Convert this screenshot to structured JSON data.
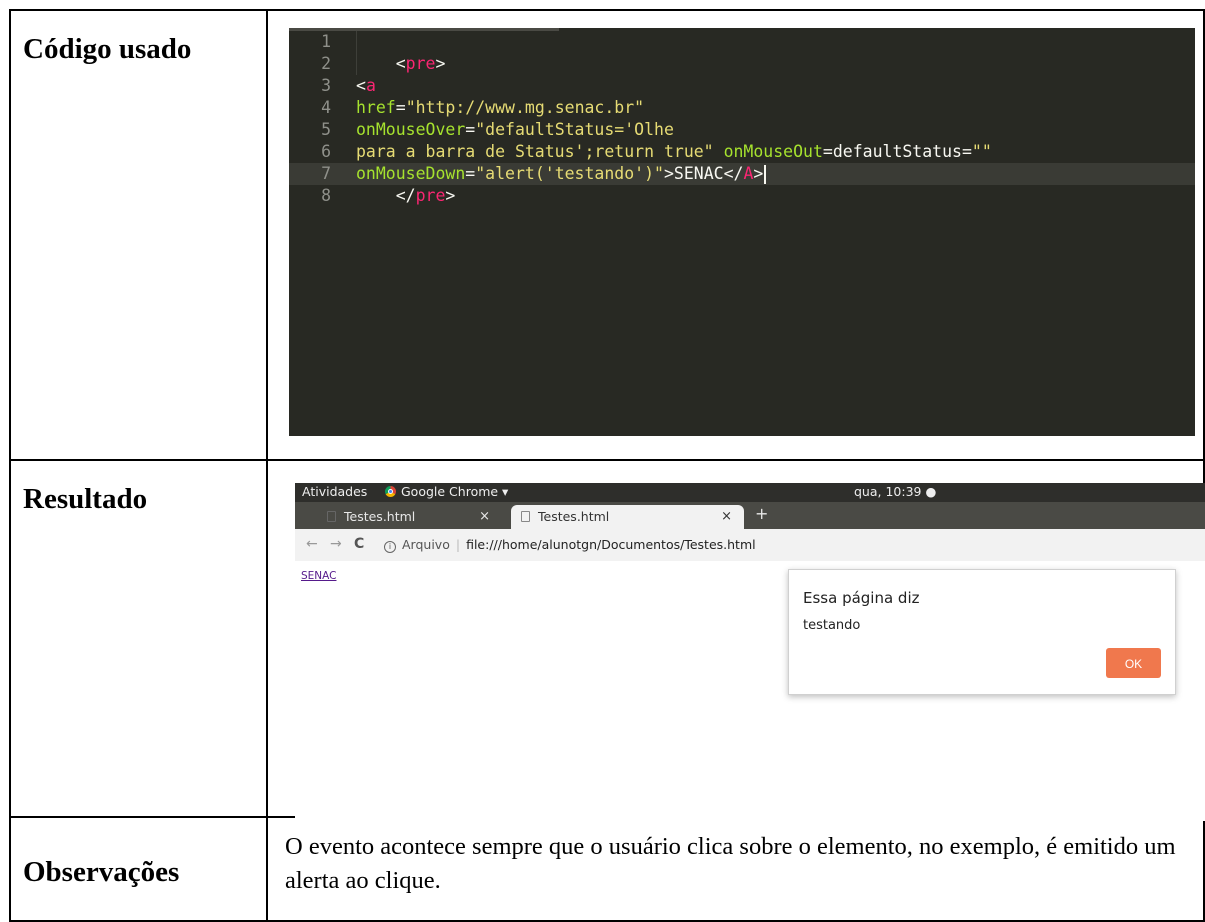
{
  "table": {
    "rows": [
      {
        "label": "Código usado"
      },
      {
        "label": "Resultado"
      },
      {
        "label": "Observações"
      }
    ]
  },
  "editor": {
    "lines": [
      {
        "n": "1",
        "parts": []
      },
      {
        "n": "2",
        "parts": [
          {
            "t": "    <",
            "c": "plain"
          },
          {
            "t": "pre",
            "c": "tag"
          },
          {
            "t": ">",
            "c": "plain"
          }
        ]
      },
      {
        "n": "3",
        "parts": [
          {
            "t": "<",
            "c": "plain"
          },
          {
            "t": "a",
            "c": "tag"
          }
        ]
      },
      {
        "n": "4",
        "parts": [
          {
            "t": "href",
            "c": "attr"
          },
          {
            "t": "=",
            "c": "plain"
          },
          {
            "t": "\"http://www.mg.senac.br\"",
            "c": "str"
          }
        ]
      },
      {
        "n": "5",
        "parts": [
          {
            "t": "onMouseOver",
            "c": "attr"
          },
          {
            "t": "=",
            "c": "plain"
          },
          {
            "t": "\"defaultStatus='Olhe",
            "c": "str"
          }
        ]
      },
      {
        "n": "6",
        "parts": [
          {
            "t": "para a barra de Status';return true\"",
            "c": "str"
          },
          {
            "t": " ",
            "c": "plain"
          },
          {
            "t": "onMouseOut",
            "c": "attr"
          },
          {
            "t": "=defaultStatus=",
            "c": "plain"
          },
          {
            "t": "\"\"",
            "c": "str"
          }
        ]
      },
      {
        "n": "7",
        "parts": [
          {
            "t": "onMouseDown",
            "c": "attr"
          },
          {
            "t": "=",
            "c": "plain"
          },
          {
            "t": "\"alert('testando')\"",
            "c": "str"
          },
          {
            "t": ">SENAC</",
            "c": "plain"
          },
          {
            "t": "A",
            "c": "tag"
          },
          {
            "t": ">",
            "c": "plain"
          }
        ],
        "caret": true
      },
      {
        "n": "8",
        "parts": [
          {
            "t": "    </",
            "c": "plain"
          },
          {
            "t": "pre",
            "c": "tag"
          },
          {
            "t": ">",
            "c": "plain"
          }
        ]
      }
    ],
    "active_line": 7
  },
  "browser": {
    "activities": "Atividades",
    "app_name": "Google Chrome ▾",
    "clock": "qua, 10:39 ●",
    "tabs": [
      {
        "title": "Testes.html",
        "close": "×"
      },
      {
        "title": "Testes.html",
        "close": "×"
      }
    ],
    "new_tab": "+",
    "nav": {
      "back": "←",
      "forward": "→",
      "reload": "C"
    },
    "info_icon": "i",
    "origin_label": "Arquivo",
    "separator": "|",
    "url": "file:///home/alunotgn/Documentos/Testes.html",
    "page_link": "SENAC",
    "dialog": {
      "title": "Essa página diz",
      "message": "testando",
      "ok": "OK"
    },
    "colors": {
      "ok_button": "#f0784d",
      "link": "#551a8b"
    }
  },
  "observacoes": {
    "text": "O evento acontece sempre que o usuário clica sobre o elemento, no exemplo, é emitido um alerta ao clique."
  }
}
